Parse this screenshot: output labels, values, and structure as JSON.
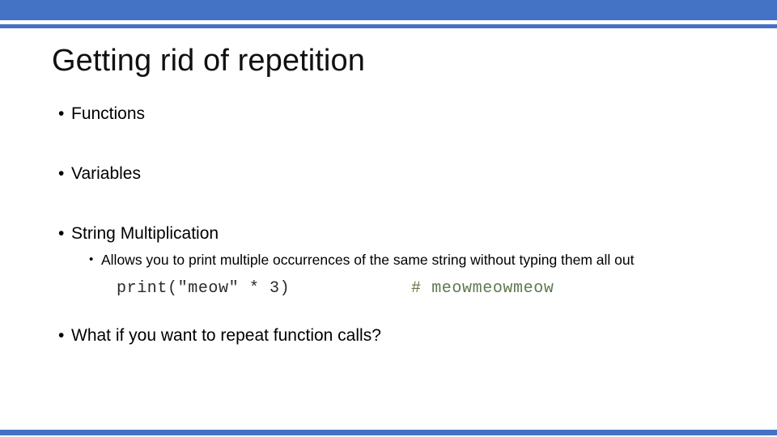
{
  "theme": {
    "accent_color": "#4472C4",
    "text_color": "#000000",
    "code_color": "#2b2b2b",
    "comment_color": "#5f7a4e",
    "background_color": "#ffffff"
  },
  "slide": {
    "title": "Getting rid of repetition",
    "bullets": [
      {
        "level": 1,
        "marker": "•",
        "text": "Functions"
      },
      {
        "level": 1,
        "marker": "•",
        "text": "Variables"
      },
      {
        "level": 1,
        "marker": "•",
        "text": "String Multiplication"
      },
      {
        "level": 2,
        "marker": "•",
        "text": "Allows you to print multiple occurrences of the same string without typing them all out"
      },
      {
        "level": 1,
        "marker": "•",
        "text": "What if you want to repeat function calls?"
      }
    ],
    "code_example": {
      "code": "print(\"meow\" * 3)",
      "comment": "# meowmeowmeow"
    }
  }
}
